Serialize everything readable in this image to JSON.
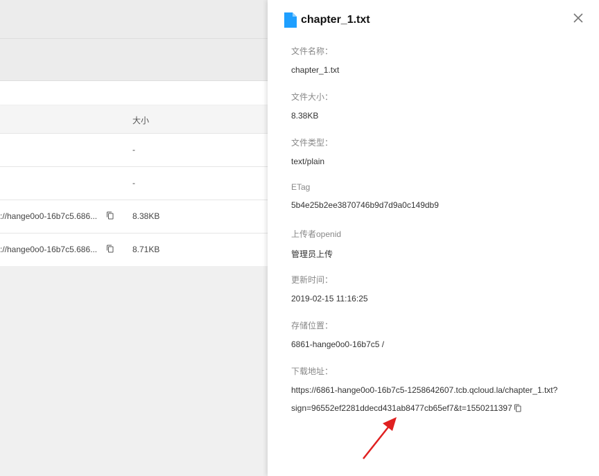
{
  "list": {
    "column_size": "大小",
    "rows": [
      {
        "url": "",
        "size": "-"
      },
      {
        "url": "",
        "size": "-"
      },
      {
        "url": "://hange0o0-16b7c5.686...",
        "size": "8.38KB"
      },
      {
        "url": "://hange0o0-16b7c5.686...",
        "size": "8.71KB"
      }
    ]
  },
  "panel": {
    "title": "chapter_1.txt",
    "fields": [
      {
        "label": "文件名称：",
        "value": "chapter_1.txt"
      },
      {
        "label": "文件大小：",
        "value": "8.38KB"
      },
      {
        "label": "文件类型：",
        "value": "text/plain"
      },
      {
        "label": "ETag",
        "value": "5b4e25b2ee3870746b9d7d9a0c149db9"
      },
      {
        "label": "上传者openid",
        "value": "管理员上传"
      },
      {
        "label": "更新时间：",
        "value": "2019-02-15 11:16:25"
      },
      {
        "label": "存储位置：",
        "value": "6861-hange0o0-16b7c5 /"
      }
    ],
    "download": {
      "label": "下载地址：",
      "line1": "https://6861-hange0o0-16b7c5-1258642607.tcb.qcloud.la/chapter_1.txt?",
      "line2": "sign=96552ef2281ddecd431ab8477cb65ef7&t=1550211397"
    }
  },
  "colors": {
    "file_icon": "#1e9fff",
    "arrow": "#e02020"
  },
  "icons": [
    "file-icon",
    "close-icon",
    "copy-icon"
  ]
}
